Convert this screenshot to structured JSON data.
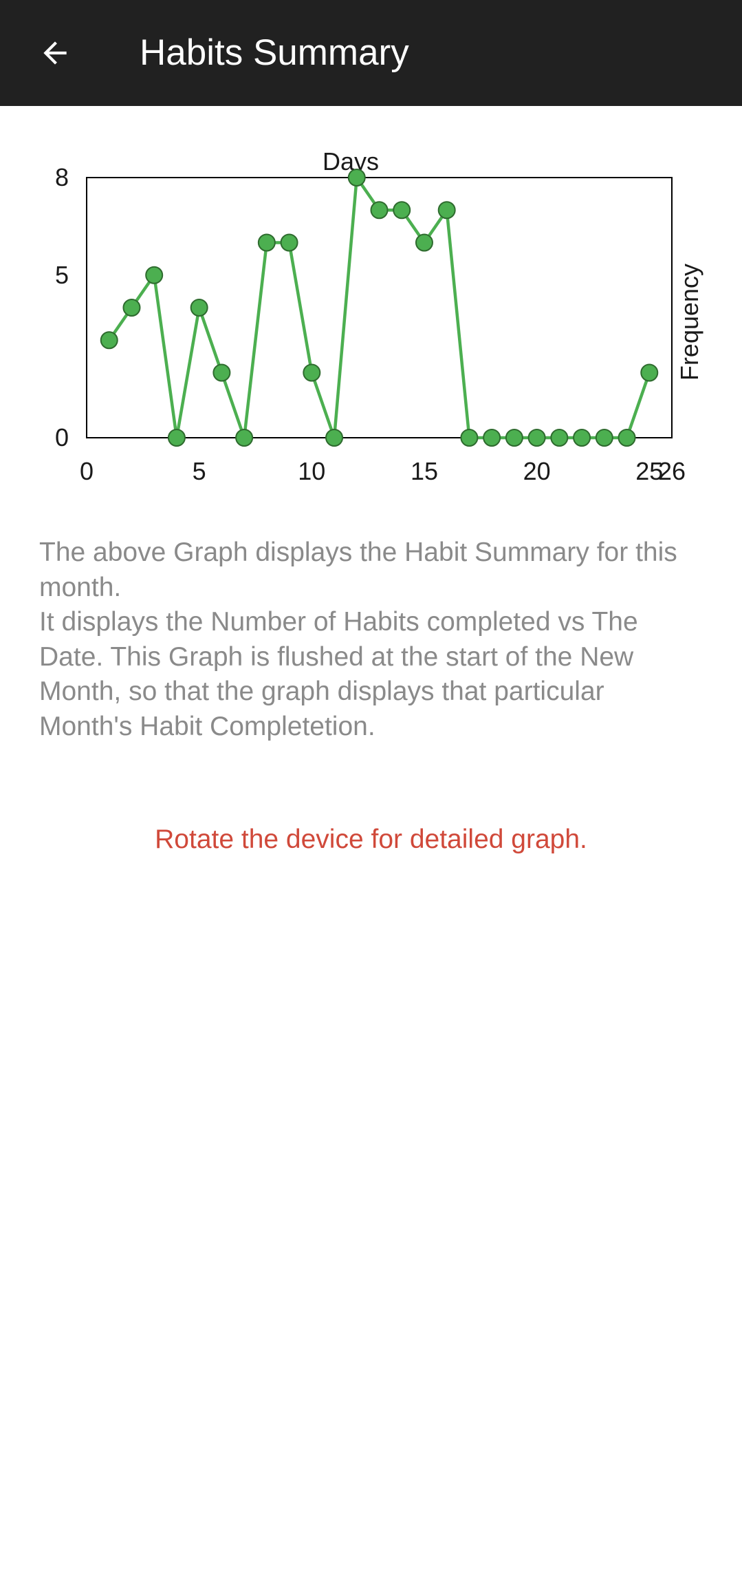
{
  "header": {
    "title": "Habits Summary",
    "back_icon": "arrow-back-icon"
  },
  "colors": {
    "app_bar": "#212121",
    "series": "#4caf50",
    "point_stroke": "#2e6b2e",
    "description_text": "#8a8a8a",
    "hint_text": "#d0493a"
  },
  "chart_data": {
    "type": "line",
    "title": "Days",
    "xlabel": "",
    "ylabel": "Frequency",
    "x_ticks": [
      "0",
      "5",
      "10",
      "15",
      "20",
      "25",
      "26"
    ],
    "y_ticks": [
      "0",
      "5",
      "8"
    ],
    "xlim": [
      0,
      26
    ],
    "ylim": [
      0,
      8
    ],
    "grid": false,
    "x": [
      1,
      2,
      3,
      4,
      5,
      6,
      7,
      8,
      9,
      10,
      11,
      12,
      13,
      14,
      15,
      16,
      17,
      18,
      19,
      20,
      21,
      22,
      23,
      24,
      25
    ],
    "series": [
      {
        "values": [
          3,
          4,
          5,
          0,
          4,
          2,
          0,
          6,
          6,
          2,
          0,
          8,
          7,
          7,
          6,
          7,
          0,
          0,
          0,
          0,
          0,
          0,
          0,
          0,
          2
        ]
      }
    ]
  },
  "description": {
    "line1": "The above Graph displays the Habit Summary for this month.",
    "line2": "It displays the Number of Habits completed vs The Date. This Graph is flushed at the start of the New Month, so that the graph displays that particular Month's Habit Completetion."
  },
  "hint": "Rotate the device for detailed graph."
}
